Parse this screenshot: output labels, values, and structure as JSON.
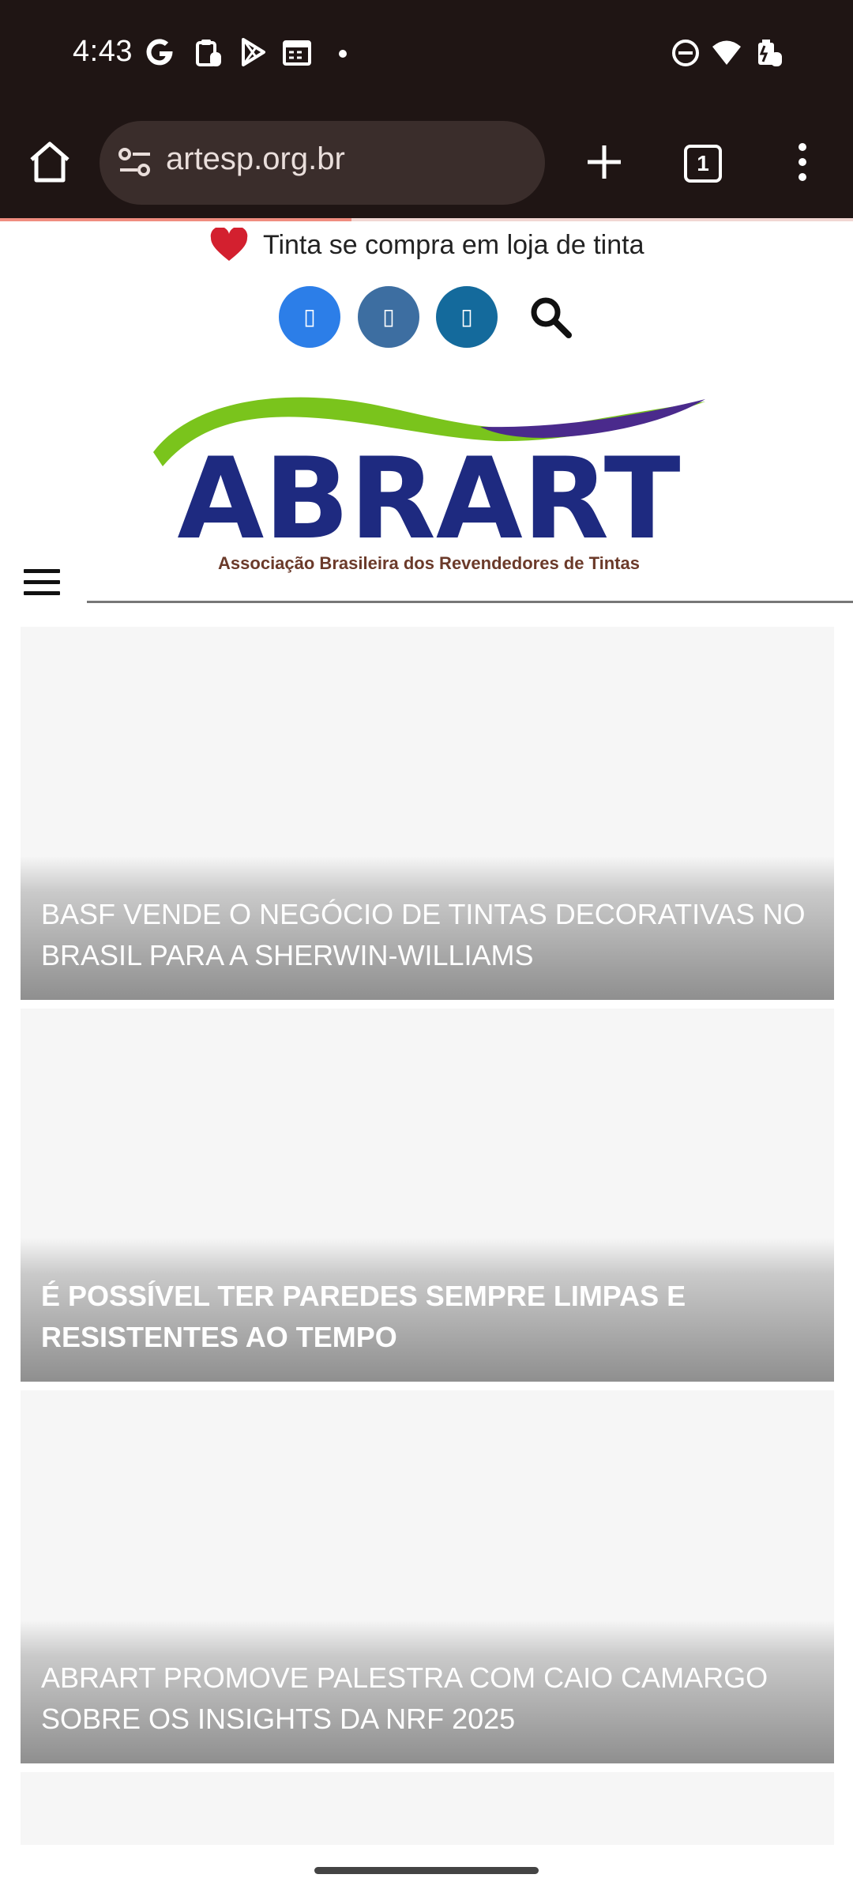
{
  "status_bar": {
    "time": "4:43",
    "left_icons": [
      "google-icon",
      "clipboard-icon",
      "play-store-icon",
      "calendar-icon",
      "dot-icon"
    ],
    "right_icons": [
      "do-not-disturb-icon",
      "wifi-icon",
      "battery-charging-icon"
    ]
  },
  "browser": {
    "url": "artesp.org.br",
    "tab_count": "1",
    "load_progress": 0.41
  },
  "page": {
    "tagline": "Tinta se compra em loja de tinta",
    "social": [
      {
        "name": "facebook",
        "glyph": "▯"
      },
      {
        "name": "instagram",
        "glyph": "▯"
      },
      {
        "name": "linkedin",
        "glyph": "▯"
      }
    ],
    "logo": {
      "name": "ABRART",
      "subtitle": "Associação Brasileira dos Revendedores de Tintas"
    },
    "articles": [
      {
        "title": "BASF VENDE O NEGÓCIO DE TINTAS DECORATIVAS NO BRASIL PARA A SHERWIN-WILLIAMS"
      },
      {
        "title": "É POSSÍVEL TER PAREDES SEMPRE LIMPAS E RESISTENTES AO TEMPO"
      },
      {
        "title": "ABRART PROMOVE PALESTRA COM CAIO CAMARGO SOBRE OS INSIGHTS DA NRF 2025"
      }
    ]
  },
  "colors": {
    "chrome_bg": "#1f1514",
    "url_box": "#3a2d2b",
    "progress": "#f08d80",
    "heart": "#d3202f",
    "logo_blue": "#1e2a80",
    "logo_green": "#7ac41c",
    "logo_purple": "#4a2a8c"
  }
}
